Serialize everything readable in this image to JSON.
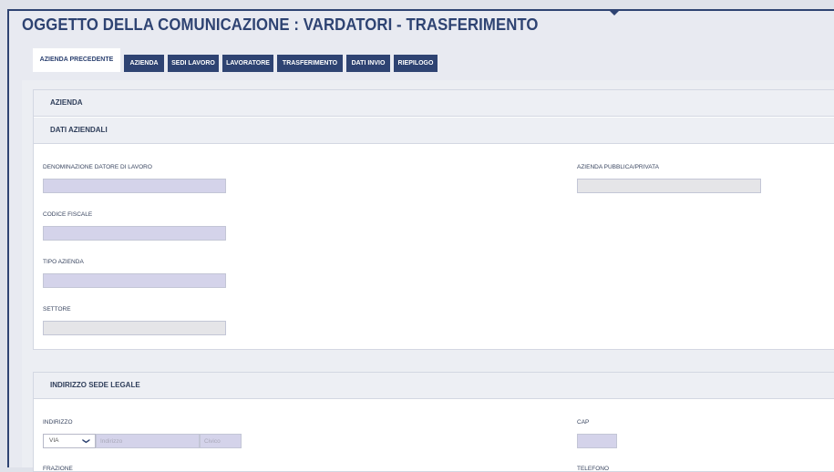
{
  "page": {
    "title": "OGGETTO DELLA COMUNICAZIONE : VARDATORI - TRASFERIMENTO"
  },
  "tabs": [
    {
      "label": "AZIENDA PRECEDENTE",
      "active": true
    },
    {
      "label": "AZIENDA",
      "active": false
    },
    {
      "label": "SEDI LAVORO",
      "active": false
    },
    {
      "label": "LAVORATORE",
      "active": false
    },
    {
      "label": "TRASFERIMENTO",
      "active": false
    },
    {
      "label": "DATI INVIO",
      "active": false
    },
    {
      "label": "RIEPILOGO",
      "active": false
    }
  ],
  "section_azienda": {
    "title": "AZIENDA",
    "dati_aziendali": {
      "title": "DATI AZIENDALI",
      "fields": {
        "denominazione": {
          "label": "DENOMINAZIONE DATORE DI LAVORO",
          "value": ""
        },
        "pubblica_privata": {
          "label": "AZIENDA PUBBLICA/PRIVATA",
          "value": ""
        },
        "codice_fiscale": {
          "label": "CODICE FISCALE",
          "value": ""
        },
        "tipo_azienda": {
          "label": "TIPO AZIENDA",
          "value": ""
        },
        "settore": {
          "label": "SETTORE",
          "value": ""
        }
      }
    }
  },
  "section_sede_legale": {
    "title": "INDIRIZZO SEDE LEGALE",
    "fields": {
      "indirizzo": {
        "label": "INDIRIZZO",
        "select_value": "VIA",
        "placeholder": "Indirizzo",
        "civico_placeholder": "Civico"
      },
      "cap": {
        "label": "CAP",
        "value": ""
      },
      "frazione": {
        "label": "FRAZIONE"
      },
      "telefono": {
        "label": "TELEFONO"
      }
    }
  },
  "colors": {
    "brand": "#2e4372",
    "input_fill": "#d4d3ea",
    "readonly_fill": "#e5e5e8"
  }
}
